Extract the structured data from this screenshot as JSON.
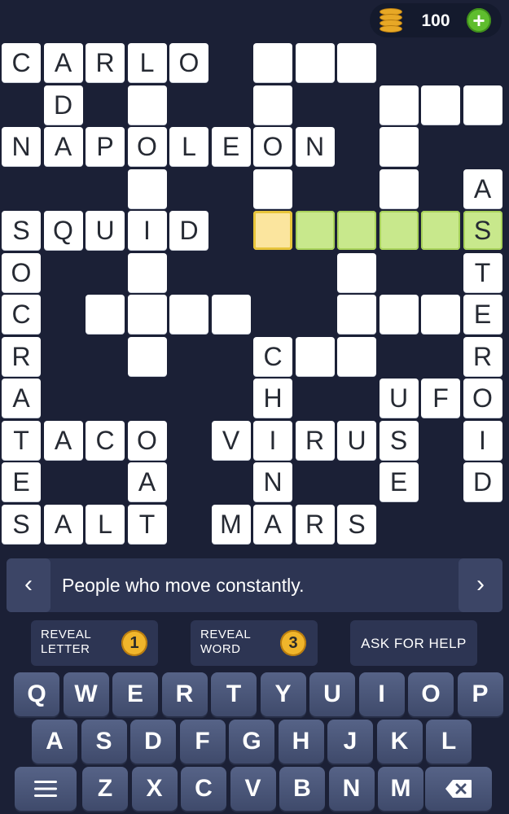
{
  "coins": {
    "count": "100",
    "icon": "coin-stack-icon",
    "add_icon": "plus-icon",
    "accent": "#5fbd2e"
  },
  "grid": {
    "colors": {
      "cell": "#ffffff",
      "active_word": "#c8e88c",
      "cursor": "#fbe59e"
    },
    "cells": [
      {
        "r": 0,
        "c": 0,
        "l": "C"
      },
      {
        "r": 0,
        "c": 1,
        "l": "A"
      },
      {
        "r": 0,
        "c": 2,
        "l": "R"
      },
      {
        "r": 0,
        "c": 3,
        "l": "L"
      },
      {
        "r": 0,
        "c": 4,
        "l": "O"
      },
      {
        "r": 0,
        "c": 6,
        "l": ""
      },
      {
        "r": 0,
        "c": 7,
        "l": ""
      },
      {
        "r": 0,
        "c": 8,
        "l": ""
      },
      {
        "r": 1,
        "c": 1,
        "l": "D"
      },
      {
        "r": 1,
        "c": 3,
        "l": ""
      },
      {
        "r": 1,
        "c": 6,
        "l": ""
      },
      {
        "r": 1,
        "c": 9,
        "l": ""
      },
      {
        "r": 1,
        "c": 10,
        "l": ""
      },
      {
        "r": 1,
        "c": 11,
        "l": ""
      },
      {
        "r": 2,
        "c": 0,
        "l": "N"
      },
      {
        "r": 2,
        "c": 1,
        "l": "A"
      },
      {
        "r": 2,
        "c": 2,
        "l": "P"
      },
      {
        "r": 2,
        "c": 3,
        "l": "O"
      },
      {
        "r": 2,
        "c": 4,
        "l": "L"
      },
      {
        "r": 2,
        "c": 5,
        "l": "E"
      },
      {
        "r": 2,
        "c": 6,
        "l": "O"
      },
      {
        "r": 2,
        "c": 7,
        "l": "N"
      },
      {
        "r": 2,
        "c": 9,
        "l": ""
      },
      {
        "r": 3,
        "c": 3,
        "l": ""
      },
      {
        "r": 3,
        "c": 6,
        "l": ""
      },
      {
        "r": 3,
        "c": 9,
        "l": ""
      },
      {
        "r": 3,
        "c": 11,
        "l": "A"
      },
      {
        "r": 4,
        "c": 0,
        "l": "S"
      },
      {
        "r": 4,
        "c": 1,
        "l": "Q"
      },
      {
        "r": 4,
        "c": 2,
        "l": "U"
      },
      {
        "r": 4,
        "c": 3,
        "l": "I"
      },
      {
        "r": 4,
        "c": 4,
        "l": "D"
      },
      {
        "r": 4,
        "c": 6,
        "l": "",
        "s": "cursor"
      },
      {
        "r": 4,
        "c": 7,
        "l": "",
        "s": "active"
      },
      {
        "r": 4,
        "c": 8,
        "l": "",
        "s": "active"
      },
      {
        "r": 4,
        "c": 9,
        "l": "",
        "s": "active"
      },
      {
        "r": 4,
        "c": 10,
        "l": "",
        "s": "active"
      },
      {
        "r": 4,
        "c": 11,
        "l": "S",
        "s": "active"
      },
      {
        "r": 5,
        "c": 0,
        "l": "O"
      },
      {
        "r": 5,
        "c": 3,
        "l": ""
      },
      {
        "r": 5,
        "c": 8,
        "l": ""
      },
      {
        "r": 5,
        "c": 11,
        "l": "T"
      },
      {
        "r": 6,
        "c": 0,
        "l": "C"
      },
      {
        "r": 6,
        "c": 2,
        "l": ""
      },
      {
        "r": 6,
        "c": 3,
        "l": ""
      },
      {
        "r": 6,
        "c": 4,
        "l": ""
      },
      {
        "r": 6,
        "c": 5,
        "l": ""
      },
      {
        "r": 6,
        "c": 8,
        "l": ""
      },
      {
        "r": 6,
        "c": 9,
        "l": ""
      },
      {
        "r": 6,
        "c": 10,
        "l": ""
      },
      {
        "r": 6,
        "c": 11,
        "l": "E"
      },
      {
        "r": 7,
        "c": 0,
        "l": "R"
      },
      {
        "r": 7,
        "c": 3,
        "l": ""
      },
      {
        "r": 7,
        "c": 6,
        "l": "C"
      },
      {
        "r": 7,
        "c": 7,
        "l": ""
      },
      {
        "r": 7,
        "c": 8,
        "l": ""
      },
      {
        "r": 7,
        "c": 11,
        "l": "R"
      },
      {
        "r": 8,
        "c": 0,
        "l": "A"
      },
      {
        "r": 8,
        "c": 6,
        "l": "H"
      },
      {
        "r": 8,
        "c": 9,
        "l": "U"
      },
      {
        "r": 8,
        "c": 10,
        "l": "F"
      },
      {
        "r": 8,
        "c": 11,
        "l": "O"
      },
      {
        "r": 9,
        "c": 0,
        "l": "T"
      },
      {
        "r": 9,
        "c": 1,
        "l": "A"
      },
      {
        "r": 9,
        "c": 2,
        "l": "C"
      },
      {
        "r": 9,
        "c": 3,
        "l": "O"
      },
      {
        "r": 9,
        "c": 5,
        "l": "V"
      },
      {
        "r": 9,
        "c": 6,
        "l": "I"
      },
      {
        "r": 9,
        "c": 7,
        "l": "R"
      },
      {
        "r": 9,
        "c": 8,
        "l": "U"
      },
      {
        "r": 9,
        "c": 9,
        "l": "S"
      },
      {
        "r": 9,
        "c": 11,
        "l": "I"
      },
      {
        "r": 10,
        "c": 0,
        "l": "E"
      },
      {
        "r": 10,
        "c": 3,
        "l": "A"
      },
      {
        "r": 10,
        "c": 6,
        "l": "N"
      },
      {
        "r": 10,
        "c": 9,
        "l": "E"
      },
      {
        "r": 10,
        "c": 11,
        "l": "D"
      },
      {
        "r": 11,
        "c": 0,
        "l": "S"
      },
      {
        "r": 11,
        "c": 1,
        "l": "A"
      },
      {
        "r": 11,
        "c": 2,
        "l": "L"
      },
      {
        "r": 11,
        "c": 3,
        "l": "T"
      },
      {
        "r": 11,
        "c": 5,
        "l": "M"
      },
      {
        "r": 11,
        "c": 6,
        "l": "A"
      },
      {
        "r": 11,
        "c": 7,
        "l": "R"
      },
      {
        "r": 11,
        "c": 8,
        "l": "S"
      }
    ]
  },
  "clue": {
    "text": "People who move constantly.",
    "prev": "‹",
    "next": "›"
  },
  "hints": {
    "reveal_letter": {
      "line1": "REVEAL",
      "line2": "LETTER",
      "cost": "1"
    },
    "reveal_word": {
      "line1": "REVEAL",
      "line2": "WORD",
      "cost": "3"
    },
    "ask_help": "ASK FOR HELP"
  },
  "keyboard": {
    "row1": [
      "Q",
      "W",
      "E",
      "R",
      "T",
      "Y",
      "U",
      "I",
      "O",
      "P"
    ],
    "row2": [
      "A",
      "S",
      "D",
      "F",
      "G",
      "H",
      "J",
      "K",
      "L"
    ],
    "row3": [
      "Z",
      "X",
      "C",
      "V",
      "B",
      "N",
      "M"
    ],
    "menu_icon": "hamburger-menu-icon",
    "backspace_icon": "backspace-icon"
  }
}
